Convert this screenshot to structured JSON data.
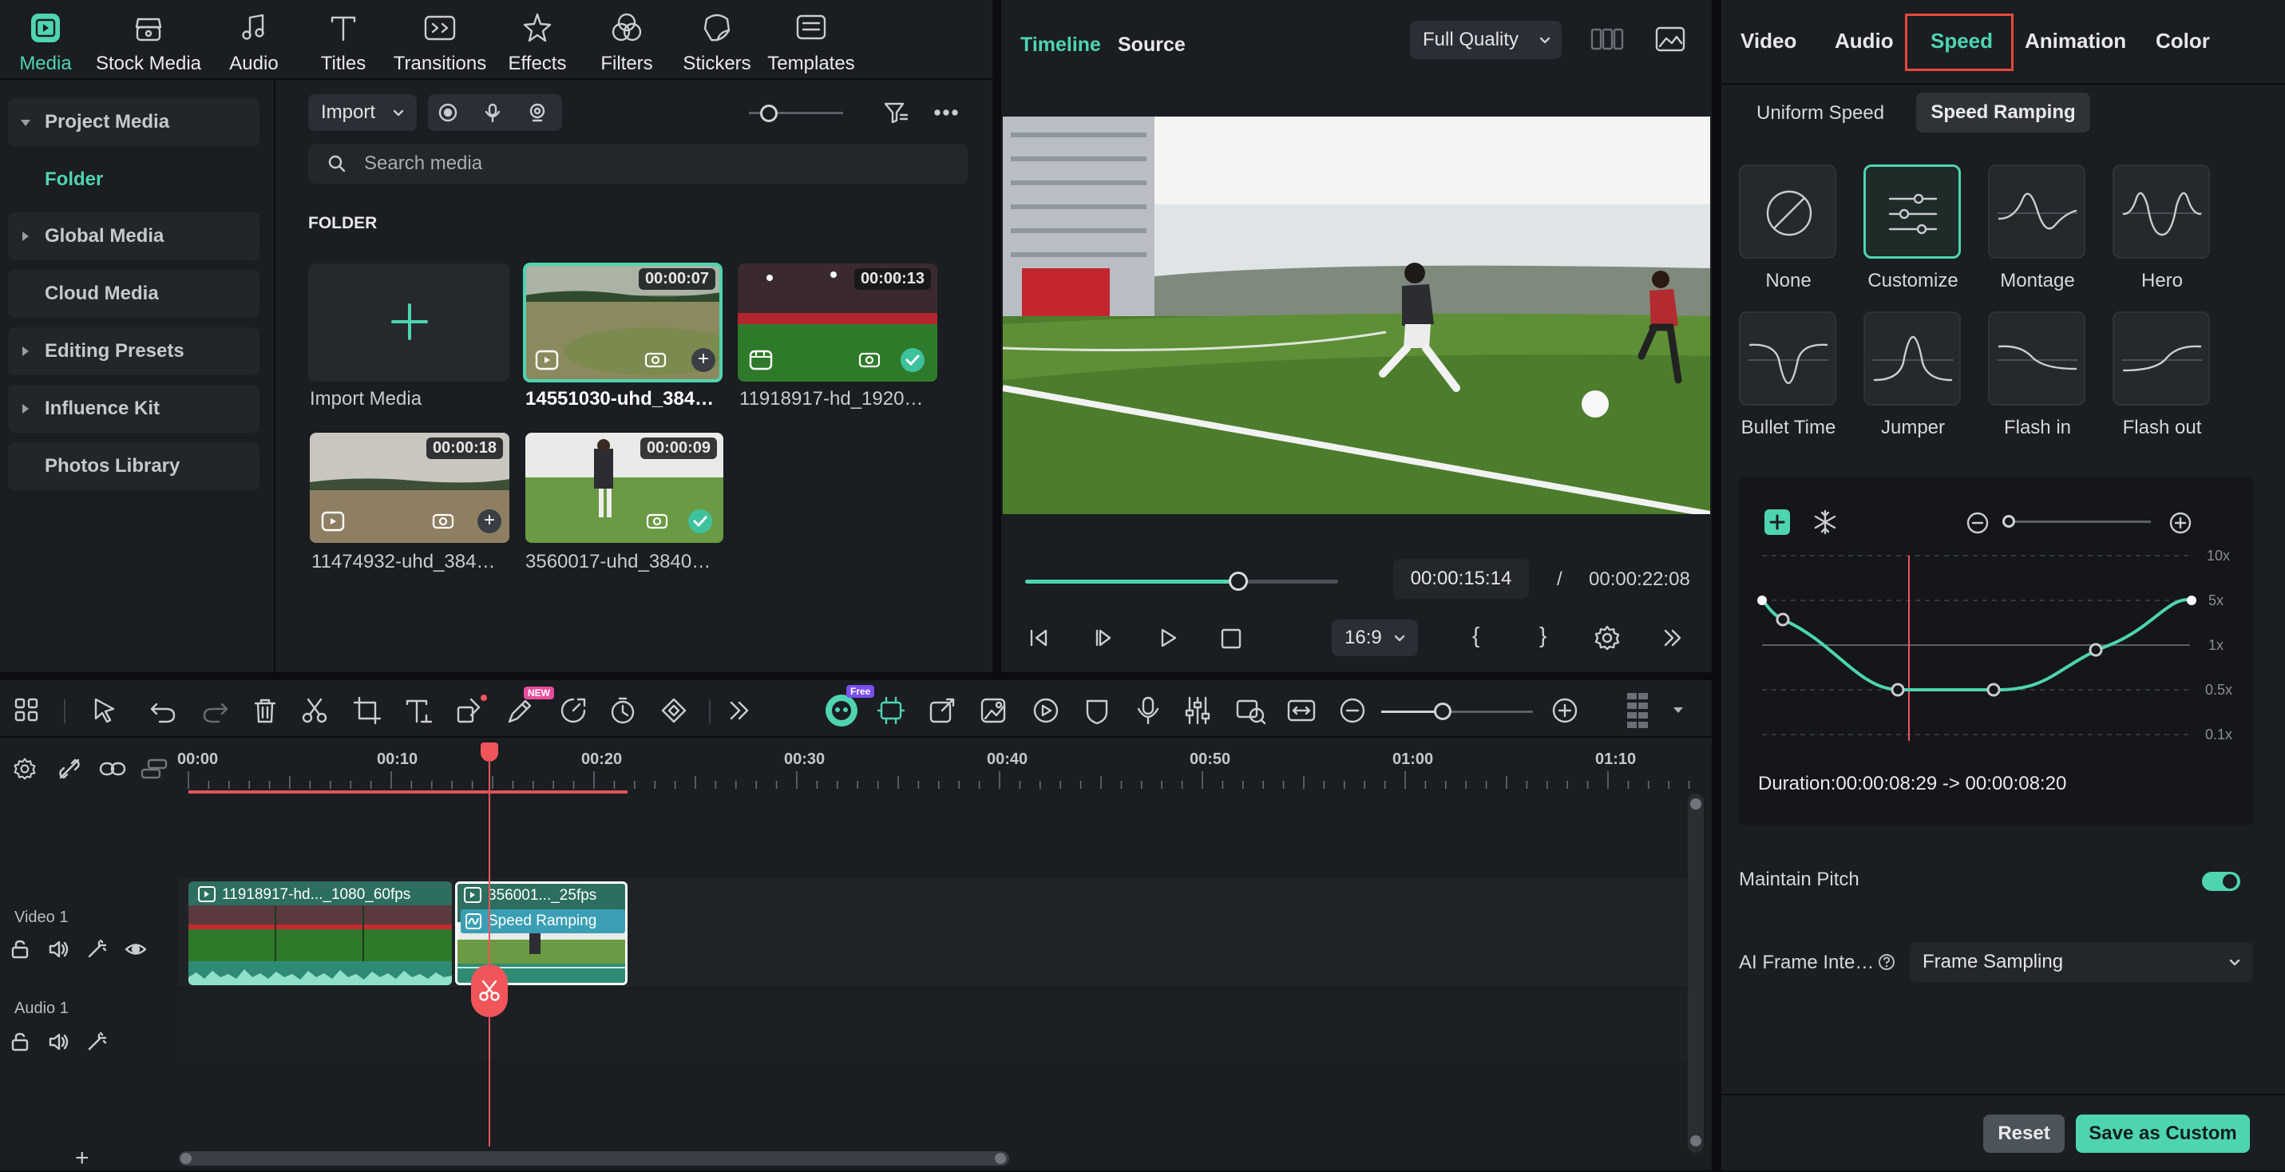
{
  "nav": {
    "items": [
      {
        "label": "Media",
        "icon": "media-icon",
        "active": true
      },
      {
        "label": "Stock Media",
        "icon": "stock-media-icon"
      },
      {
        "label": "Audio",
        "icon": "music-note-icon"
      },
      {
        "label": "Titles",
        "icon": "title-t-icon"
      },
      {
        "label": "Transitions",
        "icon": "transitions-icon"
      },
      {
        "label": "Effects",
        "icon": "effects-star-icon"
      },
      {
        "label": "Filters",
        "icon": "filters-icon"
      },
      {
        "label": "Stickers",
        "icon": "stickers-icon"
      },
      {
        "label": "Templates",
        "icon": "templates-icon"
      }
    ]
  },
  "sidebar": {
    "items": [
      {
        "label": "Project Media",
        "expanded": true
      },
      {
        "label": "Folder"
      },
      {
        "label": "Global Media"
      },
      {
        "label": "Cloud Media"
      },
      {
        "label": "Editing Presets"
      },
      {
        "label": "Influence Kit"
      },
      {
        "label": "Photos Library"
      }
    ]
  },
  "browser": {
    "import_label": "Import",
    "search_placeholder": "Search media",
    "folder_heading": "FOLDER",
    "import_media_label": "Import Media",
    "clips": [
      {
        "name": "14551030-uhd_384…",
        "duration": "00:00:07",
        "selected": true
      },
      {
        "name": "11918917-hd_1920…",
        "duration": "00:00:13",
        "checked": true
      },
      {
        "name": "11474932-uhd_384…",
        "duration": "00:00:18"
      },
      {
        "name": "3560017-uhd_3840…",
        "duration": "00:00:09",
        "checked": true
      }
    ]
  },
  "preview": {
    "tabs": [
      "Timeline",
      "Source"
    ],
    "quality": "Full Quality",
    "current_time": "00:00:15:14",
    "separator": "/",
    "total_time": "00:00:22:08",
    "aspect": "16:9",
    "progress": 0.68,
    "mark_in": "{",
    "mark_out": "}"
  },
  "right": {
    "tabs": [
      "Video",
      "Audio",
      "Speed",
      "Animation",
      "Color"
    ],
    "active_tab": "Speed",
    "subtabs": [
      "Uniform Speed",
      "Speed Ramping"
    ],
    "active_subtab": "Speed Ramping",
    "presets": [
      "None",
      "Customize",
      "Montage",
      "Hero",
      "Bullet Time",
      "Jumper",
      "Flash in",
      "Flash out"
    ],
    "selected_preset": "Customize",
    "graph_levels": [
      "10x",
      "5x",
      "1x",
      "0.5x",
      "0.1x"
    ],
    "duration_text": "Duration:00:00:08:29 -> 00:00:08:20",
    "maintain_pitch_label": "Maintain Pitch",
    "maintain_pitch_on": true,
    "ai_frame_label": "AI Frame Inte…",
    "ai_frame_value": "Frame Sampling",
    "reset_label": "Reset",
    "save_custom_label": "Save as Custom"
  },
  "timeline": {
    "ruler": [
      "00:00",
      "00:10",
      "00:20",
      "00:30",
      "00:40",
      "00:50",
      "01:00",
      "01:10"
    ],
    "tracks": [
      {
        "label": "Video 1"
      },
      {
        "label": "Audio 1"
      }
    ],
    "clip1_name": "11918917-hd..._1080_60fps",
    "clip2_name": "356001..._25fps",
    "clip2_effect": "Speed Ramping",
    "badge_new": "NEW",
    "badge_free": "Free"
  },
  "colors": {
    "accent": "#4ed4b1",
    "playhead": "#f0555a",
    "highlight_box": "#e8483c"
  }
}
